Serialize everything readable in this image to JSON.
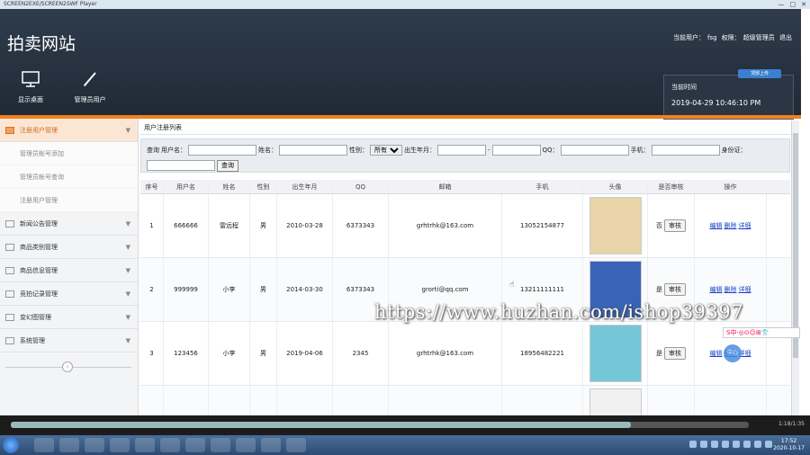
{
  "window": {
    "title": "SCREEN2EXE/SCREEN2SWF Player",
    "controls": [
      "—",
      "□",
      "✕"
    ]
  },
  "header": {
    "site_title": "拍卖网站",
    "current_user_label": "当前用户：",
    "current_user": "fsg",
    "role_label": "权限：",
    "role": "超级管理员",
    "logout": "退出"
  },
  "nav_tiles": [
    {
      "label": "显示桌面",
      "icon": "monitor-icon"
    },
    {
      "label": "管理员用户",
      "icon": "pencil-icon"
    }
  ],
  "timebox": {
    "label": "当前时间",
    "value": "2019-04-29 10:46:10 PM",
    "badge": "顶部上传"
  },
  "sidebar": {
    "groups": [
      {
        "label": "注册用户管理",
        "active": true,
        "items": [
          "管理员帐号添加",
          "管理员帐号查询",
          "注册用户管理"
        ]
      },
      {
        "label": "新闻公告管理"
      },
      {
        "label": "商品类别管理"
      },
      {
        "label": "商品信息管理"
      },
      {
        "label": "竞拍记录管理"
      },
      {
        "label": "变幻图管理"
      },
      {
        "label": "系统管理"
      }
    ],
    "collapse_glyph": "‹"
  },
  "content": {
    "title": "用户注册列表",
    "search": {
      "query_label": "查询",
      "username_label": "用户名：",
      "name_label": "姓名：",
      "gender_label": "性别：",
      "gender_value": "所有",
      "birth_label": "出生年月：",
      "birth_sep": "-",
      "qq_label": "QQ：",
      "phone_label": "手机：",
      "idcard_label": "身份证：",
      "search_button": "查询"
    },
    "columns": [
      "序号",
      "用户名",
      "姓名",
      "性别",
      "出生年月",
      "QQ",
      "邮箱",
      "手机",
      "头像",
      "是否审核",
      "操作"
    ],
    "rows": [
      {
        "no": "1",
        "username": "666666",
        "name": "雷远程",
        "gender": "男",
        "birth": "2010-03-28",
        "qq": "6373343",
        "email": "grhtrhk@163.com",
        "phone": "13052154877",
        "avatar_color": "#e8d4a8",
        "audited": "否",
        "audit_btn": "审核"
      },
      {
        "no": "2",
        "username": "999999",
        "name": "小李",
        "gender": "男",
        "birth": "2014-03-30",
        "qq": "6373343",
        "email": "grorti@qq.com",
        "phone": "13211111111",
        "avatar_color": "#3a63b8",
        "audited": "是",
        "audit_btn": "审核"
      },
      {
        "no": "3",
        "username": "123456",
        "name": "小李",
        "gender": "男",
        "birth": "2019-04-06",
        "qq": "2345",
        "email": "grhtrhk@163.com",
        "phone": "18956482221",
        "avatar_color": "#74c7d6",
        "audited": "是",
        "audit_btn": "审核"
      },
      {
        "no": "",
        "username": "",
        "name": "",
        "gender": "",
        "birth": "",
        "qq": "",
        "email": "",
        "phone": "",
        "avatar_color": "#f0f0f0",
        "audited": "",
        "audit_btn": ""
      }
    ],
    "ops": {
      "edit": "编辑",
      "delete": "删除",
      "detail": "详细"
    }
  },
  "watermark": "https://www.huzhan.com/ishop39397",
  "ime_bar": "S中·◎⊙☺⊞👕",
  "float_ball": "中心",
  "player": {
    "time": "1:18/1:35",
    "progress": 0.84
  },
  "taskbar": {
    "time": "17:52",
    "date": "2020-10-17"
  }
}
